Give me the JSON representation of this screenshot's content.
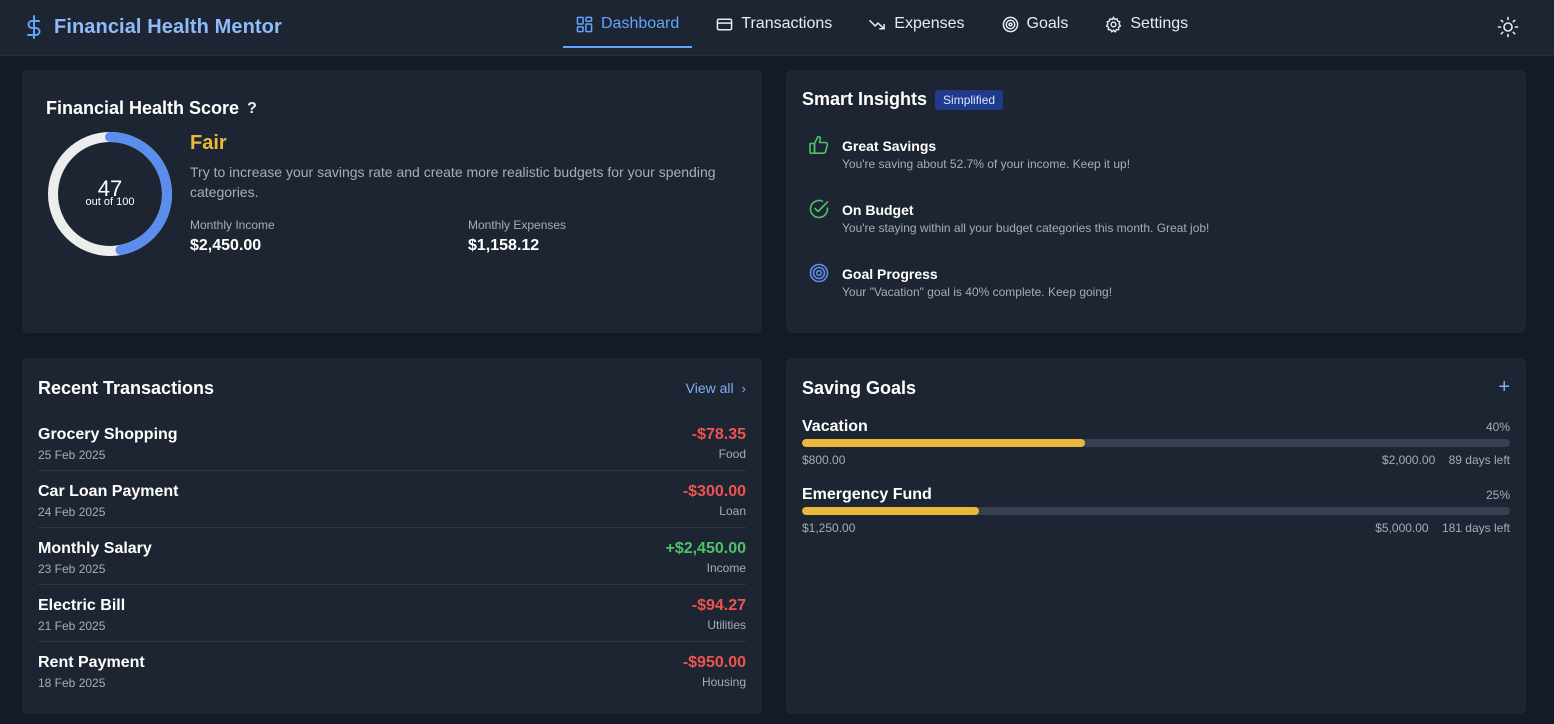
{
  "app": {
    "title": "Financial Health Mentor"
  },
  "nav": {
    "items": [
      {
        "label": "Dashboard",
        "icon": "dashboard-grid-icon",
        "active": true
      },
      {
        "label": "Transactions",
        "icon": "credit-card-icon",
        "active": false
      },
      {
        "label": "Expenses",
        "icon": "trending-down-icon",
        "active": false
      },
      {
        "label": "Goals",
        "icon": "target-icon",
        "active": false
      },
      {
        "label": "Settings",
        "icon": "gear-icon",
        "active": false
      }
    ],
    "theme_toggle_icon": "sun-icon"
  },
  "health": {
    "title": "Financial Health Score",
    "help": "?",
    "score": "47",
    "score_value": 47,
    "score_max": 100,
    "score_sub": "out of 100",
    "rating": "Fair",
    "advice": "Try to increase your savings rate and create more realistic budgets for your spending categories.",
    "income_label": "Monthly Income",
    "income_value": "$2,450.00",
    "expenses_label": "Monthly Expenses",
    "expenses_value": "$1,158.12"
  },
  "insights": {
    "title": "Smart Insights",
    "badge": "Simplified",
    "items": [
      {
        "title": "Great Savings",
        "text": "You're saving about 52.7% of your income. Keep it up!",
        "icon": "thumbs-up-icon"
      },
      {
        "title": "On Budget",
        "text": "You're staying within all your budget categories this month. Great job!",
        "icon": "check-circle-icon"
      },
      {
        "title": "Goal Progress",
        "text": "Your \"Vacation\" goal is 40% complete. Keep going!",
        "icon": "target-icon"
      }
    ]
  },
  "transactions": {
    "title": "Recent Transactions",
    "view_all": "View all",
    "rows": [
      {
        "name": "Grocery Shopping",
        "date": "25 Feb 2025",
        "amount": "-$78.35",
        "category": "Food",
        "type": "expense"
      },
      {
        "name": "Car Loan Payment",
        "date": "24 Feb 2025",
        "amount": "-$300.00",
        "category": "Loan",
        "type": "expense"
      },
      {
        "name": "Monthly Salary",
        "date": "23 Feb 2025",
        "amount": "+$2,450.00",
        "category": "Income",
        "type": "income"
      },
      {
        "name": "Electric Bill",
        "date": "21 Feb 2025",
        "amount": "-$94.27",
        "category": "Utilities",
        "type": "expense"
      },
      {
        "name": "Rent Payment",
        "date": "18 Feb 2025",
        "amount": "-$950.00",
        "category": "Housing",
        "type": "expense"
      }
    ]
  },
  "goals": {
    "title": "Saving Goals",
    "add": "+",
    "items": [
      {
        "name": "Vacation",
        "percent_label": "40%",
        "progress": 0.4,
        "current": "$800.00",
        "target": "$2,000.00",
        "days_left": "89 days left"
      },
      {
        "name": "Emergency Fund",
        "percent_label": "25%",
        "progress": 0.25,
        "current": "$1,250.00",
        "target": "$5,000.00",
        "days_left": "181 days left"
      }
    ]
  },
  "colors": {
    "accent": "#60a5fa",
    "rating_fair": "#eab93c",
    "negative": "#ef5350",
    "positive": "#4cc26b",
    "progress_fill": "#eab93c"
  }
}
